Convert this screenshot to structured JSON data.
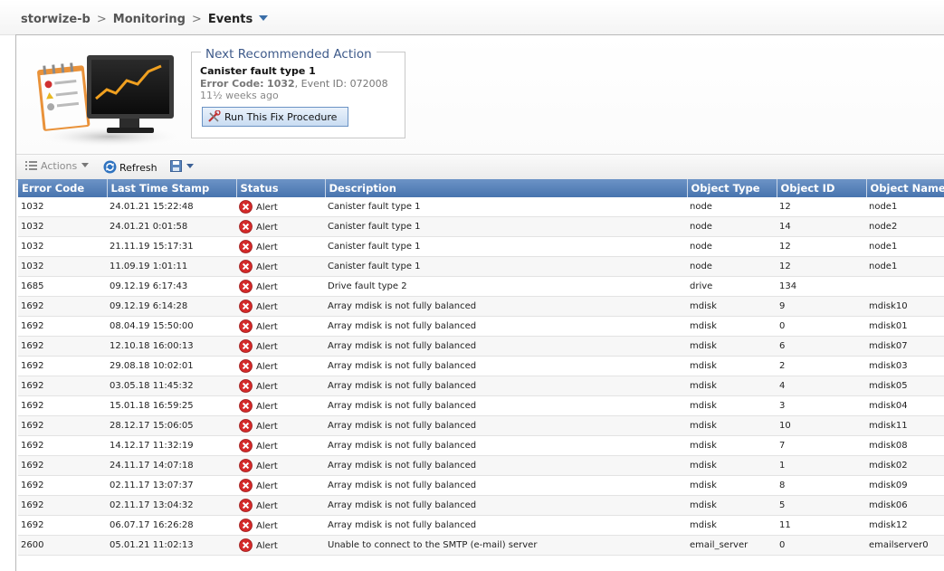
{
  "breadcrumb": {
    "items": [
      "storwize-b",
      "Monitoring",
      "Events"
    ],
    "separator": ">"
  },
  "recommended_action": {
    "heading": "Next Recommended Action",
    "title": "Canister fault type 1",
    "error_code_label": "Error Code:",
    "error_code": "1032",
    "event_id_text": ", Event ID: 072008",
    "age": "11½ weeks ago",
    "button_label": "Run This Fix Procedure"
  },
  "toolbar": {
    "actions_label": "Actions",
    "refresh_label": "Refresh"
  },
  "table": {
    "columns": [
      "Error Code",
      "Last Time Stamp",
      "Status",
      "Description",
      "Object Type",
      "Object ID",
      "Object Name"
    ],
    "rows": [
      {
        "error_code": "1032",
        "timestamp": "24.01.21 15:22:48",
        "status": "Alert",
        "description": "Canister fault type 1",
        "object_type": "node",
        "object_id": "12",
        "object_name": "node1"
      },
      {
        "error_code": "1032",
        "timestamp": "24.01.21 0:01:58",
        "status": "Alert",
        "description": "Canister fault type 1",
        "object_type": "node",
        "object_id": "14",
        "object_name": "node2"
      },
      {
        "error_code": "1032",
        "timestamp": "21.11.19 15:17:31",
        "status": "Alert",
        "description": "Canister fault type 1",
        "object_type": "node",
        "object_id": "12",
        "object_name": "node1"
      },
      {
        "error_code": "1032",
        "timestamp": "11.09.19 1:01:11",
        "status": "Alert",
        "description": "Canister fault type 1",
        "object_type": "node",
        "object_id": "12",
        "object_name": "node1"
      },
      {
        "error_code": "1685",
        "timestamp": "09.12.19 6:17:43",
        "status": "Alert",
        "description": "Drive fault type 2",
        "object_type": "drive",
        "object_id": "134",
        "object_name": ""
      },
      {
        "error_code": "1692",
        "timestamp": "09.12.19 6:14:28",
        "status": "Alert",
        "description": "Array mdisk is not fully balanced",
        "object_type": "mdisk",
        "object_id": "9",
        "object_name": "mdisk10"
      },
      {
        "error_code": "1692",
        "timestamp": "08.04.19 15:50:00",
        "status": "Alert",
        "description": "Array mdisk is not fully balanced",
        "object_type": "mdisk",
        "object_id": "0",
        "object_name": "mdisk01"
      },
      {
        "error_code": "1692",
        "timestamp": "12.10.18 16:00:13",
        "status": "Alert",
        "description": "Array mdisk is not fully balanced",
        "object_type": "mdisk",
        "object_id": "6",
        "object_name": "mdisk07"
      },
      {
        "error_code": "1692",
        "timestamp": "29.08.18 10:02:01",
        "status": "Alert",
        "description": "Array mdisk is not fully balanced",
        "object_type": "mdisk",
        "object_id": "2",
        "object_name": "mdisk03"
      },
      {
        "error_code": "1692",
        "timestamp": "03.05.18 11:45:32",
        "status": "Alert",
        "description": "Array mdisk is not fully balanced",
        "object_type": "mdisk",
        "object_id": "4",
        "object_name": "mdisk05"
      },
      {
        "error_code": "1692",
        "timestamp": "15.01.18 16:59:25",
        "status": "Alert",
        "description": "Array mdisk is not fully balanced",
        "object_type": "mdisk",
        "object_id": "3",
        "object_name": "mdisk04"
      },
      {
        "error_code": "1692",
        "timestamp": "28.12.17 15:06:05",
        "status": "Alert",
        "description": "Array mdisk is not fully balanced",
        "object_type": "mdisk",
        "object_id": "10",
        "object_name": "mdisk11"
      },
      {
        "error_code": "1692",
        "timestamp": "14.12.17 11:32:19",
        "status": "Alert",
        "description": "Array mdisk is not fully balanced",
        "object_type": "mdisk",
        "object_id": "7",
        "object_name": "mdisk08"
      },
      {
        "error_code": "1692",
        "timestamp": "24.11.17 14:07:18",
        "status": "Alert",
        "description": "Array mdisk is not fully balanced",
        "object_type": "mdisk",
        "object_id": "1",
        "object_name": "mdisk02"
      },
      {
        "error_code": "1692",
        "timestamp": "02.11.17 13:07:37",
        "status": "Alert",
        "description": "Array mdisk is not fully balanced",
        "object_type": "mdisk",
        "object_id": "8",
        "object_name": "mdisk09"
      },
      {
        "error_code": "1692",
        "timestamp": "02.11.17 13:04:32",
        "status": "Alert",
        "description": "Array mdisk is not fully balanced",
        "object_type": "mdisk",
        "object_id": "5",
        "object_name": "mdisk06"
      },
      {
        "error_code": "1692",
        "timestamp": "06.07.17 16:26:28",
        "status": "Alert",
        "description": "Array mdisk is not fully balanced",
        "object_type": "mdisk",
        "object_id": "11",
        "object_name": "mdisk12"
      },
      {
        "error_code": "2600",
        "timestamp": "05.01.21 11:02:13",
        "status": "Alert",
        "description": "Unable to connect to the SMTP (e-mail) server",
        "object_type": "email_server",
        "object_id": "0",
        "object_name": "emailserver0"
      }
    ]
  },
  "icons": {
    "status": "alert-x-icon",
    "refresh": "refresh-icon",
    "save": "save-icon",
    "actions": "list-icon",
    "fix": "wrench-icon"
  },
  "colors": {
    "header_blue": "#4874ae",
    "alert_red": "#cc0000",
    "button_border": "#6b93c4"
  }
}
